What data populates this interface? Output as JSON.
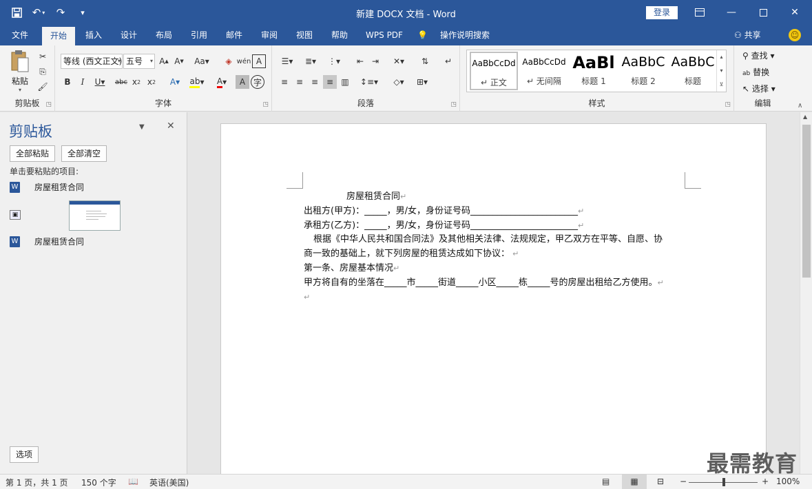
{
  "window": {
    "title": "新建 DOCX 文档  -  Word",
    "login": "登录",
    "qat_icons": [
      "save-icon",
      "undo-icon",
      "redo-icon",
      "customize-icon"
    ]
  },
  "tabs": [
    "文件",
    "开始",
    "插入",
    "设计",
    "布局",
    "引用",
    "邮件",
    "审阅",
    "视图",
    "帮助",
    "WPS PDF",
    "操作说明搜索"
  ],
  "active_tab": "开始",
  "share": "共享",
  "ribbon": {
    "clipboard": {
      "label": "剪贴板",
      "paste": "粘贴"
    },
    "font": {
      "label": "字体",
      "font_name": "等线 (西文正文)",
      "font_size": "五号"
    },
    "paragraph": {
      "label": "段落"
    },
    "styles": {
      "label": "样式",
      "items": [
        {
          "sample": "AaBbCcDd",
          "name": "正文"
        },
        {
          "sample": "AaBbCcDd",
          "name": "无间隔"
        },
        {
          "sample": "AaBl",
          "name": "标题 1"
        },
        {
          "sample": "AaBbC",
          "name": "标题 2"
        },
        {
          "sample": "AaBbC",
          "name": "标题"
        }
      ]
    },
    "editing": {
      "label": "编辑",
      "find": "查找",
      "replace": "替换",
      "select": "选择"
    }
  },
  "clipboard_pane": {
    "title": "剪贴板",
    "paste_all": "全部粘贴",
    "clear_all": "全部清空",
    "hint": "单击要粘贴的项目:",
    "items": [
      "房屋租赁合同",
      "房屋租赁合同"
    ],
    "options": "选项"
  },
  "document": {
    "lines": [
      "房屋租赁合同",
      "出租方(甲方)：_____，男/女，身份证号码________________________",
      "承租方(乙方)：_____，男/女，身份证号码________________________",
      "根据《中华人民共和国合同法》及其他相关法律、法规规定，甲乙双方在平等、自愿、协",
      "商一致的基础上，就下列房屋的租赁达成如下协议：",
      "第一条、房屋基本情况",
      "甲方将自有的坐落在_____市_____街道_____小区_____栋_____号的房屋出租给乙方使用。",
      ""
    ]
  },
  "watermark": "最需教育",
  "status": {
    "page": "第 1 页，共 1 页",
    "words": "150 个字",
    "language": "英语(美国)",
    "zoom": "100%",
    "zoom_fraction": 0.5
  }
}
